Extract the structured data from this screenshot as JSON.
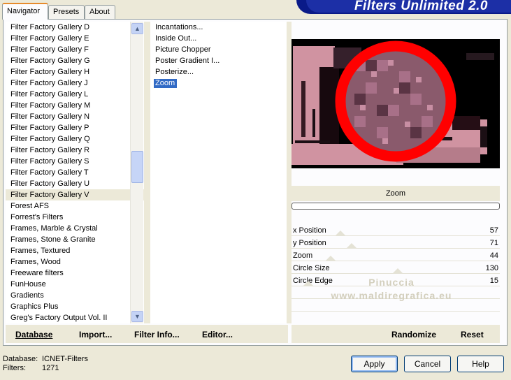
{
  "tabs": [
    "Navigator",
    "Presets",
    "About"
  ],
  "banner_title": "Filters Unlimited 2.0",
  "categories": [
    "Filter Factory Gallery D",
    "Filter Factory Gallery E",
    "Filter Factory Gallery F",
    "Filter Factory Gallery G",
    "Filter Factory Gallery H",
    "Filter Factory Gallery J",
    "Filter Factory Gallery L",
    "Filter Factory Gallery M",
    "Filter Factory Gallery N",
    "Filter Factory Gallery P",
    "Filter Factory Gallery Q",
    "Filter Factory Gallery R",
    "Filter Factory Gallery S",
    "Filter Factory Gallery T",
    "Filter Factory Gallery U",
    "Filter Factory Gallery V",
    "Forest AFS",
    "Forrest's Filters",
    "Frames, Marble & Crystal",
    "Frames, Stone & Granite",
    "Frames, Textured",
    "Frames, Wood",
    "Freeware filters",
    "FunHouse",
    "Gradients",
    "Graphics Plus",
    "Greg's Factory Output Vol. II"
  ],
  "selected_category": "Filter Factory Gallery V",
  "filters": [
    "Incantations...",
    "Inside Out...",
    "Picture Chopper",
    "Poster Gradient I...",
    "Posterize...",
    "Zoom"
  ],
  "selected_filter": "Zoom",
  "filter_name": "Zoom",
  "params": [
    {
      "label": "x Position",
      "value": "57",
      "level": 57
    },
    {
      "label": "y Position",
      "value": "71",
      "level": 71
    },
    {
      "label": "Zoom",
      "value": "44",
      "level": 44
    },
    {
      "label": "Circle Size",
      "value": "130",
      "level": 130
    },
    {
      "label": "Circle Edge",
      "value": "15",
      "level": 15
    }
  ],
  "watermark": {
    "line1": "Pinuccia",
    "line2": "www.maldiregrafica.eu"
  },
  "bottom_left": {
    "database": "Database",
    "import": "Import...",
    "filter_info": "Filter Info...",
    "editor": "Editor..."
  },
  "bottom_right": {
    "randomize": "Randomize",
    "reset": "Reset"
  },
  "status": {
    "database_label": "Database:",
    "database_value": "ICNET-Filters",
    "filters_label": "Filters:",
    "filters_value": "1271"
  },
  "buttons": {
    "apply": "Apply",
    "cancel": "Cancel",
    "help": "Help"
  },
  "colors": {
    "selection": "#316ac5",
    "preview_circle": "#ff0000",
    "preview_pink": "#e7a4b3"
  }
}
